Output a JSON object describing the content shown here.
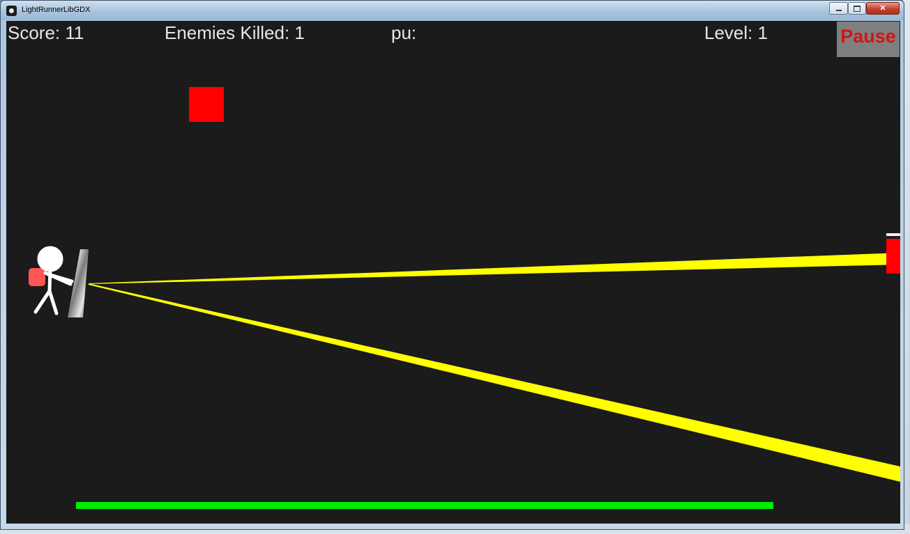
{
  "window": {
    "title": "LightRunnerLibGDX",
    "close_glyph": "✕"
  },
  "hud": {
    "score": "Score: 11",
    "enemies_killed": "Enemies Killed: 1",
    "powerup": "pu:",
    "level": "Level: 1"
  },
  "pause": {
    "label": "Pause"
  },
  "colors": {
    "background": "#1b1b1b",
    "hud_text": "#e6e6e6",
    "pause_bg": "#7f7f7f",
    "pause_text": "#d41414",
    "enemy": "#ff0000",
    "light_beam": "#ffff00",
    "health_bar": "#00ee00",
    "player": "#ffffff",
    "backpack": "#ff5555"
  },
  "icons": {
    "app": "lightrunner-app-icon",
    "player": "stickman-player",
    "mirror": "mirror-shield"
  }
}
